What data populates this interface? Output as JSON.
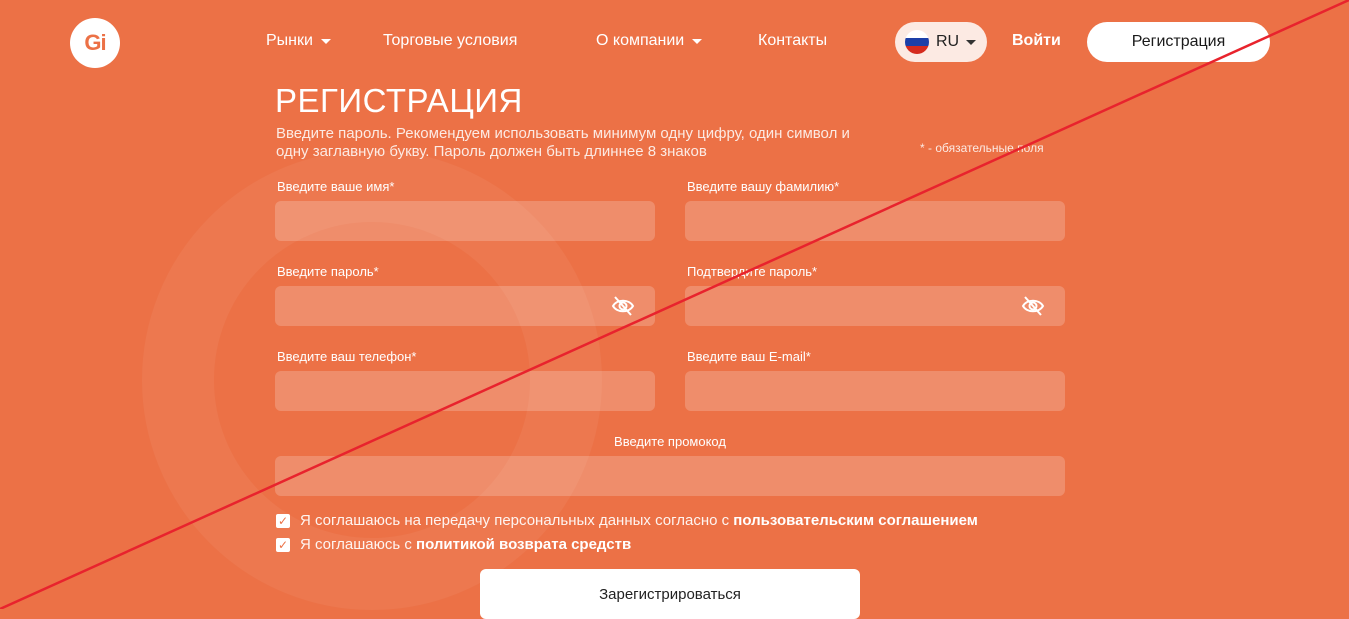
{
  "header": {
    "logo_text": "Gi",
    "nav": [
      {
        "label": "Рынки",
        "has_dropdown": true
      },
      {
        "label": "Торговые условия",
        "has_dropdown": false
      },
      {
        "label": "О компании",
        "has_dropdown": true
      },
      {
        "label": "Контакты",
        "has_dropdown": false
      }
    ],
    "language": "RU",
    "login_label": "Войти",
    "register_label": "Регистрация"
  },
  "form": {
    "title": "РЕГИСТРАЦИЯ",
    "hint": "Введите пароль. Рекомендуем использовать минимум одну цифру, один символ и одну заглавную букву. Пароль должен быть длиннее 8 знаков",
    "required_note": "* - обязательные поля",
    "first_name_label": "Введите ваше имя*",
    "last_name_label": "Введите вашу фамилию*",
    "password_label": "Введите пароль*",
    "confirm_password_label": "Подтвердите пароль*",
    "phone_label": "Введите ваш телефон*",
    "email_label": "Введите ваш E-mail*",
    "promo_label": "Введите промокод",
    "agree_personal_text": "Я соглашаюсь на передачу персональных данных согласно с ",
    "agree_personal_link": "пользовательским соглашением",
    "agree_refund_text": "Я соглашаюсь с ",
    "agree_refund_link": "политикой возврата средств",
    "submit_label": "Зарегистрироваться"
  },
  "colors": {
    "background": "#ec7146",
    "overlay_line": "#e8232d"
  }
}
